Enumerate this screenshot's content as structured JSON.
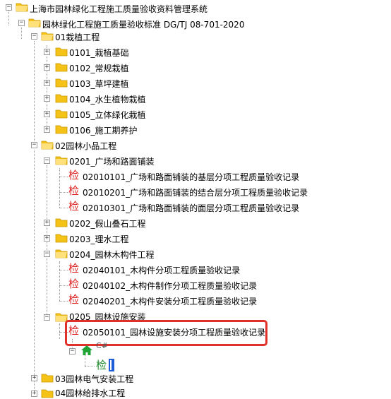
{
  "tree": {
    "root": "上海市园林绿化工程施工质量验收资料管理系统",
    "standard": "园林绿化工程施工质量验收标准 DG/TJ 08-701-2020",
    "n01": "01栽植工程",
    "n0101": "0101_栽植基础",
    "n0102": "0102_常规栽植",
    "n0103": "0103_草坪建植",
    "n0104": "0104_水生植物栽植",
    "n0105": "0105_立体绿化栽植",
    "n0106": "0106_施工期养护",
    "n02": "02园林小品工程",
    "n0201": "0201_广场和路面铺装",
    "r02010101": "02010101_广场和路面铺装的基层分项工程质量验收记录",
    "r02010201": "02010201_广场和路面铺装的结合层分项工程质量验收记录",
    "r02010301": "02010301_广场和路面铺装的面层分项工程质量验收记录",
    "n0202": "0202_假山叠石工程",
    "n0203": "0203_理水工程",
    "n0204": "0204_园林木构件工程",
    "r02040101": "02040101_木构件分项工程质量验收记录",
    "r02040102": "02040102_木构件制作分项工程质量验收记录",
    "r02040201": "02040201_木构件安装分项工程质量验收记录",
    "n0205": "0205_园林设施安装",
    "r02050101": "02050101_园林设施安装分项工程质量验收记录",
    "sub": "C#",
    "n03": "03园林电气安装工程",
    "n04": "04园林给排水工程"
  },
  "record_icon_char": "检",
  "icons": {
    "folder": "folder-icon",
    "record": "record-icon",
    "home": "home-icon"
  },
  "colors": {
    "folder": "#f5c318",
    "record": "#d22222",
    "record_green": "#1a8a2a",
    "highlight": "#e0302a",
    "home": "#1fa335",
    "selection": "#1e5dd8"
  }
}
